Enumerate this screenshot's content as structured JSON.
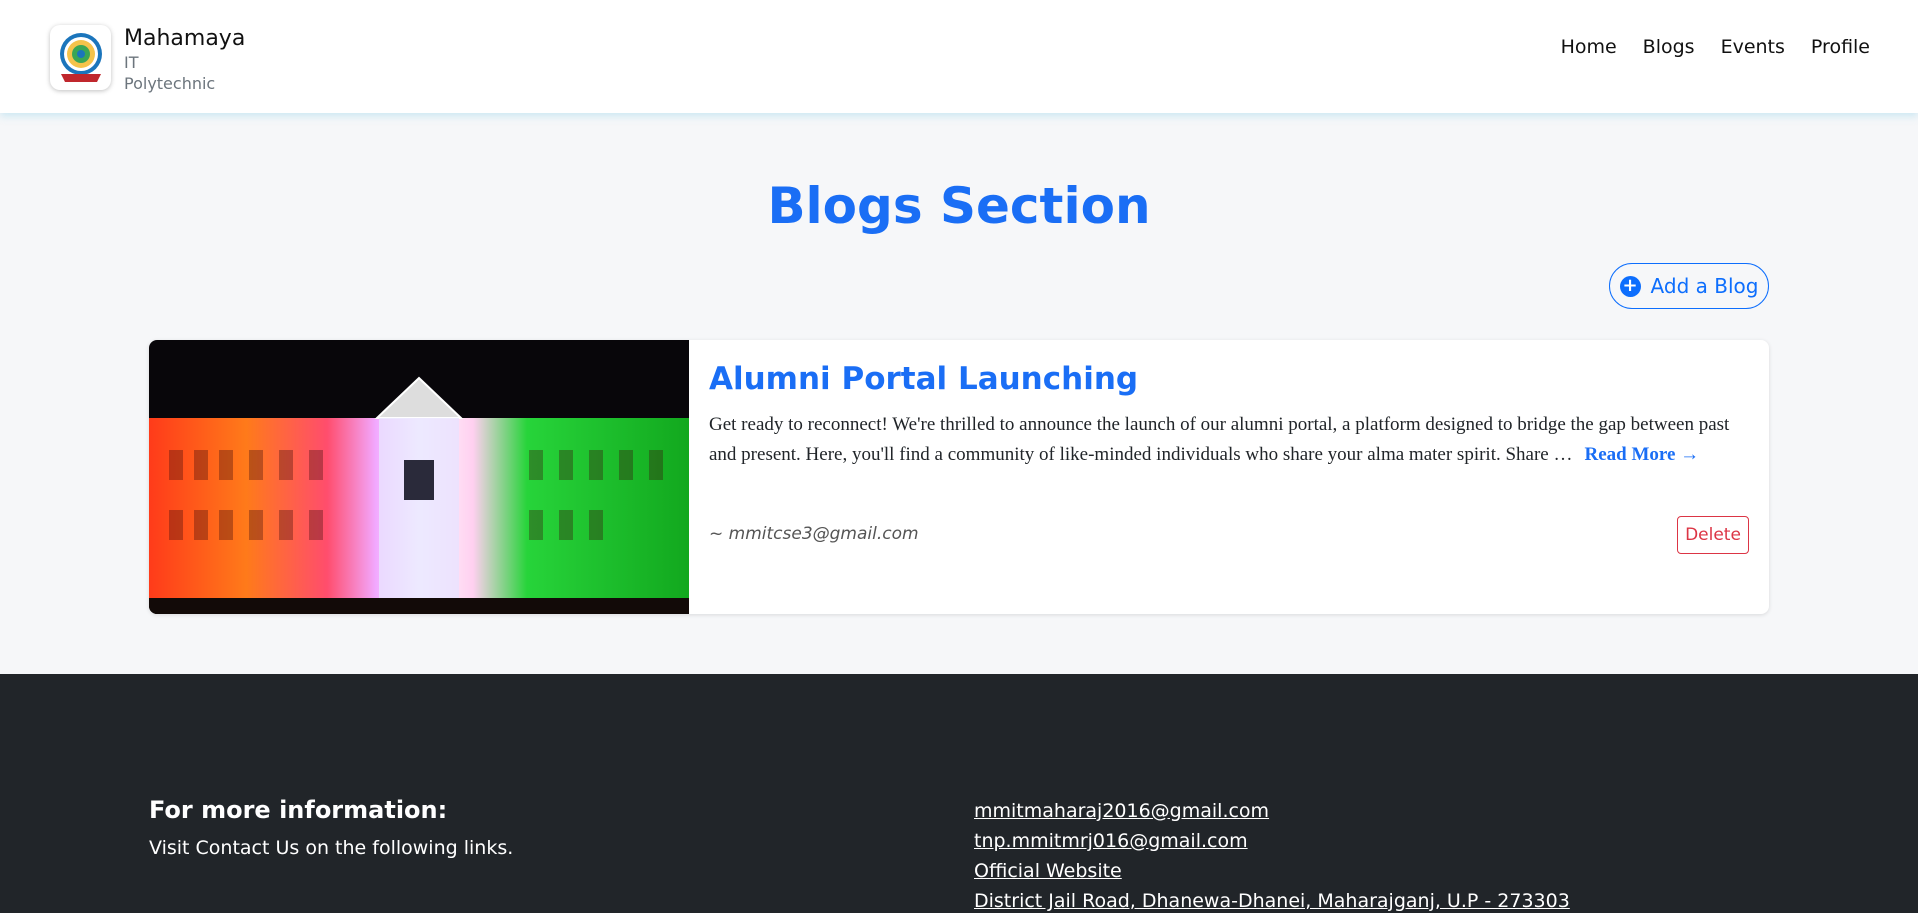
{
  "brand": {
    "name": "Mahamaya",
    "line1": "IT",
    "line2": "Polytechnic",
    "logo_icon": "college-emblem-icon"
  },
  "nav": {
    "items": [
      "Home",
      "Blogs",
      "Events",
      "Profile"
    ]
  },
  "page": {
    "title": "Blogs Section",
    "add_button": "Add a Blog",
    "add_icon": "plus-circle-icon"
  },
  "blog": {
    "title": "Alumni Portal Launching",
    "excerpt": "Get ready to reconnect! We're thrilled to announce the launch of our alumni portal, a platform designed to bridge the gap between past and present. Here, you'll find a community of like-minded individuals who share your alma mater spirit. Share …",
    "read_more": "Read More →",
    "author": "~ mmitcse3@gmail.com",
    "delete_label": "Delete",
    "image_alt": "college building lit in tricolor"
  },
  "footer": {
    "heading": "For more information:",
    "subtext": "Visit Contact Us on the following links.",
    "links": [
      "mmitmaharaj2016@gmail.com",
      "tnp.mmitmrj016@gmail.com",
      "Official Website",
      "District Jail Road, Dhanewa-Dhanei, Maharajganj, U.P - 273303"
    ]
  },
  "colors": {
    "primary": "#1a6ef5",
    "danger": "#dc3545",
    "footer_bg": "#212529",
    "page_bg": "#f6f7f9"
  }
}
